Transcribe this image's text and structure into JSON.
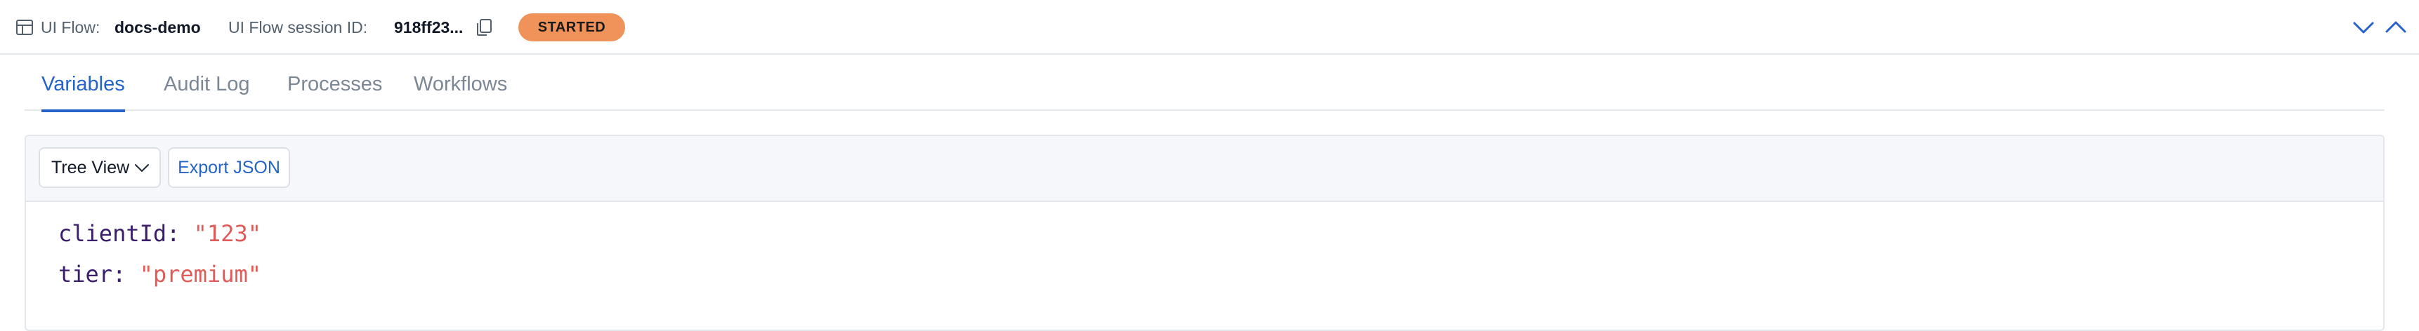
{
  "header": {
    "flow_label": "UI Flow:",
    "flow_name": "docs-demo",
    "session_label": "UI Flow session ID:",
    "session_id": "918ff23...",
    "status": "STARTED",
    "icons": {
      "flow": "layout-table-icon",
      "copy": "copy-icon",
      "collapse": "chevron-down-icon",
      "expand": "chevron-up-icon"
    }
  },
  "tabs": [
    {
      "label": "Variables",
      "active": true
    },
    {
      "label": "Audit Log",
      "active": false
    },
    {
      "label": "Processes",
      "active": false
    },
    {
      "label": "Workflows",
      "active": false
    }
  ],
  "toolbar": {
    "view_select": "Tree View",
    "export_label": "Export JSON"
  },
  "variables": [
    {
      "key": "clientId",
      "value": "\"123\""
    },
    {
      "key": "tier",
      "value": "\"premium\""
    }
  ],
  "colors": {
    "accent": "#2563c9",
    "status_badge": "#f0935a",
    "json_key": "#3b1e6b",
    "json_string": "#e05a57"
  }
}
